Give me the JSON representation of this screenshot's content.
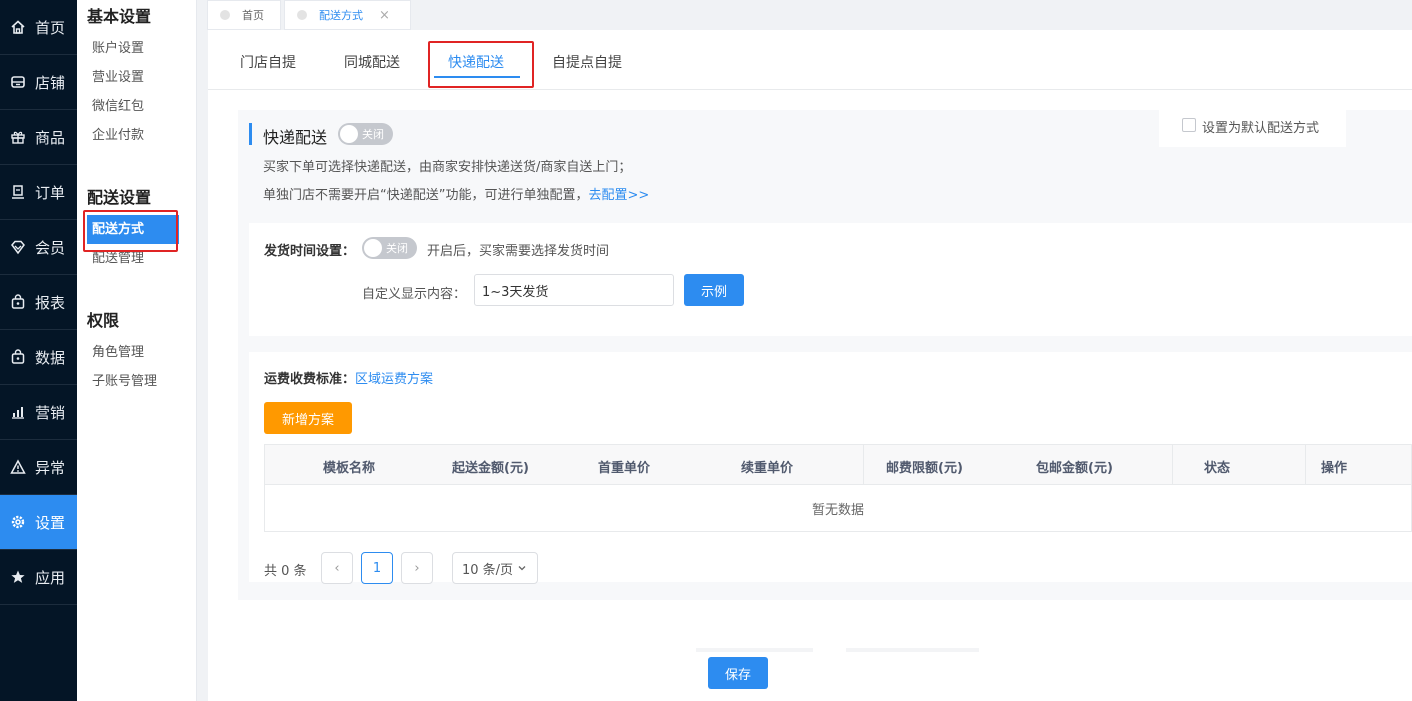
{
  "sidebar": {
    "items": [
      {
        "label": "首页",
        "icon": "home-icon"
      },
      {
        "label": "店铺",
        "icon": "store-icon"
      },
      {
        "label": "商品",
        "icon": "gift-icon"
      },
      {
        "label": "订单",
        "icon": "order-icon"
      },
      {
        "label": "会员",
        "icon": "diamond-icon"
      },
      {
        "label": "报表",
        "icon": "report-icon"
      },
      {
        "label": "数据",
        "icon": "data-icon"
      },
      {
        "label": "营销",
        "icon": "bar-chart-icon"
      },
      {
        "label": "异常",
        "icon": "warning-icon"
      },
      {
        "label": "设置",
        "icon": "gear-icon"
      },
      {
        "label": "应用",
        "icon": "star-icon"
      }
    ]
  },
  "subnav": {
    "basic_title": "基本设置",
    "basic_items": [
      "账户设置",
      "营业设置",
      "微信红包",
      "企业付款"
    ],
    "delivery_title": "配送设置",
    "delivery_items": [
      "配送方式",
      "配送管理"
    ],
    "perm_title": "权限",
    "perm_items": [
      "角色管理",
      "子账号管理"
    ]
  },
  "page_tabs": {
    "home": "首页",
    "current": "配送方式",
    "close": "×"
  },
  "delivery_tabs": [
    "门店自提",
    "同城配送",
    "快递配送",
    "自提点自提"
  ],
  "express": {
    "title": "快递配送",
    "switch_label": "关闭",
    "default_checkbox_label": "设置为默认配送方式",
    "desc1": "买家下单可选择快递配送，由商家安排快递送货/商家自送上门；",
    "desc2": "单独门店不需要开启“快递配送”功能，可进行单独配置，",
    "config_link": "去配置>>"
  },
  "ship_time": {
    "label": "发货时间设置：",
    "switch_label": "关闭",
    "hint": "开启后，买家需要选择发货时间",
    "custom_label": "自定义显示内容：",
    "custom_value": "1~3天发货",
    "example_button": "示例"
  },
  "freight": {
    "label": "运费收费标准：",
    "link": "区域运费方案",
    "add_button": "新增方案",
    "columns": [
      "模板名称",
      "起送金额(元)",
      "首重单价",
      "续重单价",
      "邮费限额(元)",
      "包邮金额(元)",
      "状态",
      "操作"
    ],
    "empty_text": "暂无数据"
  },
  "pager": {
    "total": "共 0 条",
    "prev": "‹",
    "current_page": "1",
    "next": "›",
    "page_size": "10 条/页"
  },
  "save_button": "保存"
}
